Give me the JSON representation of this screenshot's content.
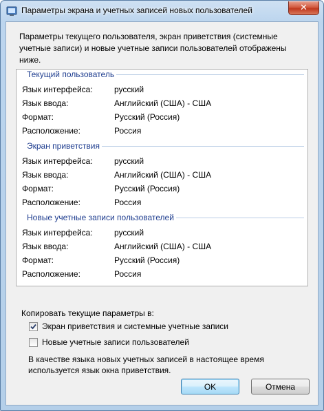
{
  "window": {
    "title": "Параметры экрана и учетных записей новых пользователей",
    "close_glyph": "✕"
  },
  "intro": "Параметры текущего пользователя, экран приветствия (системные учетные записи) и новые учетные записи пользователей отображены ниже.",
  "labels": {
    "ui_language": "Язык интерфейса:",
    "input_language": "Язык ввода:",
    "format": "Формат:",
    "location": "Расположение:"
  },
  "sections": [
    {
      "title": "Текущий пользователь",
      "ui_language": "русский",
      "input_language": "Английский (США) - США",
      "format": "Русский (Россия)",
      "location": "Россия"
    },
    {
      "title": "Экран приветствия",
      "ui_language": "русский",
      "input_language": "Английский (США) - США",
      "format": "Русский (Россия)",
      "location": "Россия"
    },
    {
      "title": "Новые учетные записи пользователей",
      "ui_language": "русский",
      "input_language": "Английский (США) - США",
      "format": "Русский (Россия)",
      "location": "Россия"
    }
  ],
  "copy": {
    "label": "Копировать текущие параметры в:",
    "options": [
      {
        "label": "Экран приветствия и системные учетные записи",
        "checked": true
      },
      {
        "label": "Новые учетные записи пользователей",
        "checked": false
      }
    ]
  },
  "note": "В качестве языка новых учетных записей в настоящее время используется язык окна приветствия.",
  "buttons": {
    "ok": "OK",
    "cancel": "Отмена"
  }
}
